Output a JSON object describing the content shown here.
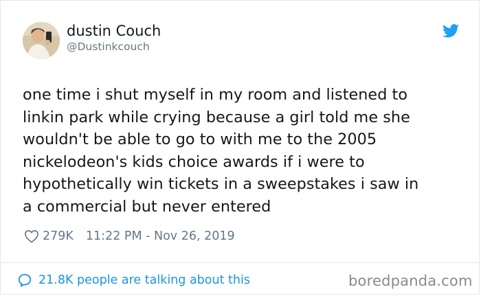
{
  "tweet": {
    "author": {
      "name": "dustin Couch",
      "handle": "@Dustinkcouch"
    },
    "text_lines": [
      "one time i shut myself in my room and listened to",
      "linkin park while crying because a girl told me she",
      "wouldn't be able to go to with me to the 2005",
      "nickelodeon's kids choice awards if i were to",
      "hypothetically win tickets in a sweepstakes i saw in",
      "a commercial but never entered"
    ],
    "likes": "279K",
    "timestamp": "11:22 PM - Nov 26, 2019",
    "talking": "21.8K people are talking about this"
  },
  "watermark": "boredpanda.com",
  "icons": {
    "brand": "twitter-bird-icon",
    "like": "heart-icon",
    "reply": "speech-bubble-icon"
  },
  "colors": {
    "twitter_blue": "#1da1f2",
    "link_blue": "#1b95e0",
    "muted_gray": "#657786",
    "text": "#14171a",
    "border": "#e1e8ed",
    "watermark": "#8a8a8a"
  }
}
